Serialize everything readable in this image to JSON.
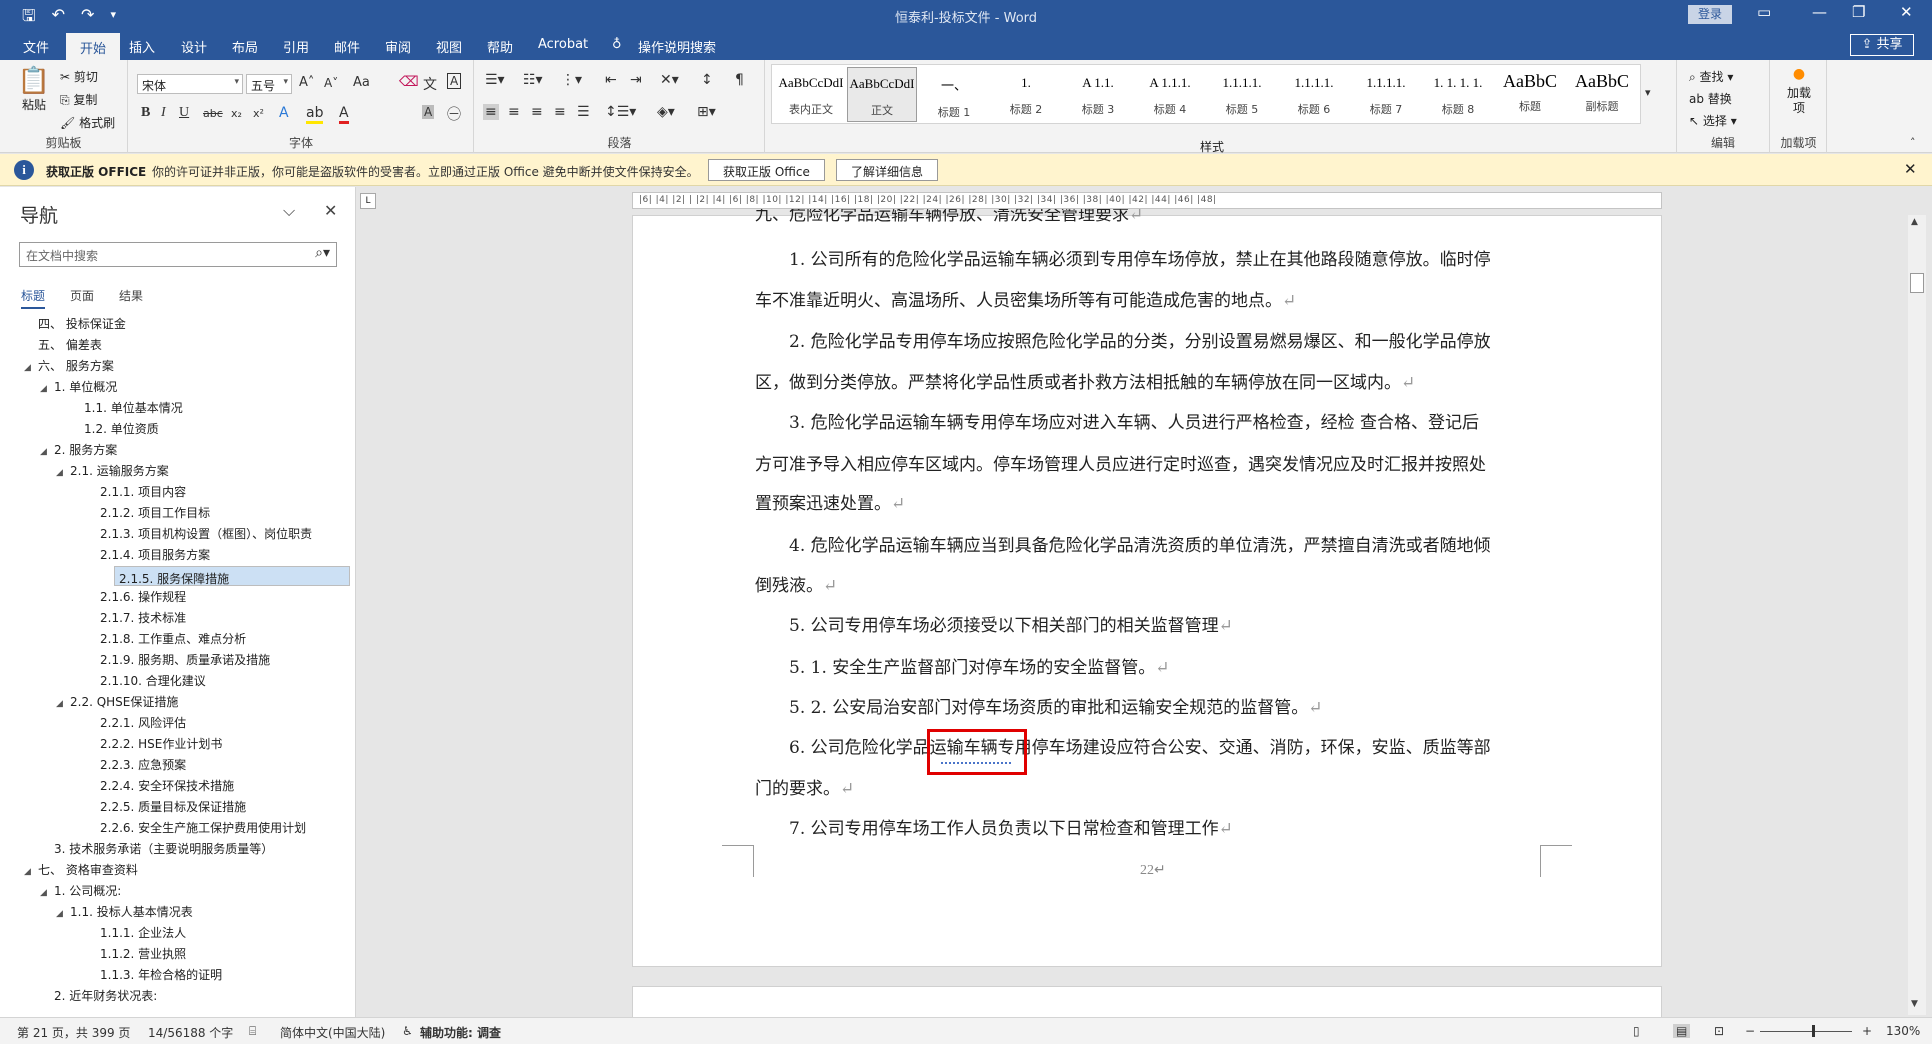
{
  "window": {
    "title": "恒泰利-投标文件 - Word",
    "login_label": "登录",
    "share_label": "共享"
  },
  "tabs": [
    "文件",
    "开始",
    "插入",
    "设计",
    "布局",
    "引用",
    "邮件",
    "审阅",
    "视图",
    "帮助",
    "Acrobat",
    "操作说明搜索"
  ],
  "ribbon": {
    "clipboard": {
      "paste": "粘贴",
      "cut": "剪切",
      "copy": "复制",
      "format_painter": "格式刷",
      "label": "剪贴板"
    },
    "font": {
      "font_name": "宋体",
      "font_size": "五号",
      "label": "字体",
      "case": "Aa"
    },
    "paragraph": {
      "label": "段落"
    },
    "styles": {
      "label": "样式",
      "items": [
        {
          "sample": "AaBbCcDdI",
          "name": "表内正文"
        },
        {
          "sample": "AaBbCcDdI",
          "name": "正文"
        },
        {
          "sample": "一、",
          "name": "标题 1"
        },
        {
          "sample": "1.",
          "name": "标题 2"
        },
        {
          "sample": "A 1.1.",
          "name": "标题 3"
        },
        {
          "sample": "A 1.1.1.",
          "name": "标题 4"
        },
        {
          "sample": "1.1.1.1.",
          "name": "标题 5"
        },
        {
          "sample": "1.1.1.1.",
          "name": "标题 6"
        },
        {
          "sample": "1.1.1.1.",
          "name": "标题 7"
        },
        {
          "sample": "1. 1. 1. 1.",
          "name": "标题 8"
        },
        {
          "sample": "AaBbC",
          "name": "标题"
        },
        {
          "sample": "AaBbC",
          "name": "副标题"
        }
      ]
    },
    "editing": {
      "find": "查找",
      "replace": "替换",
      "select": "选择",
      "label": "编辑"
    },
    "addins": {
      "name": "加载项",
      "label": "加载项"
    }
  },
  "message_bar": {
    "title": "获取正版 OFFICE",
    "text": "你的许可证并非正版，你可能是盗版软件的受害者。立即通过正版 Office 避免中断并使文件保持安全。",
    "btn_get": "获取正版 Office",
    "btn_more": "了解详细信息"
  },
  "nav": {
    "title": "导航",
    "search_placeholder": "在文档中搜索",
    "tabs": [
      "标题",
      "页面",
      "结果"
    ],
    "tree": [
      {
        "label": "四、 投标保证金",
        "level": 0,
        "toggle": ""
      },
      {
        "label": "五、 偏差表",
        "level": 0,
        "toggle": ""
      },
      {
        "label": "六、 服务方案",
        "level": 0,
        "toggle": "◢"
      },
      {
        "label": "1. 单位概况",
        "level": 1,
        "toggle": "◢"
      },
      {
        "label": "1.1. 单位基本情况",
        "level": 2,
        "toggle": ""
      },
      {
        "label": "1.2. 单位资质",
        "level": 2,
        "toggle": ""
      },
      {
        "label": "2. 服务方案",
        "level": 1,
        "toggle": "◢"
      },
      {
        "label": "2.1. 运输服务方案",
        "level": 2,
        "toggle": "◢"
      },
      {
        "label": "2.1.1. 项目内容",
        "level": 3,
        "toggle": ""
      },
      {
        "label": "2.1.2. 项目工作目标",
        "level": 3,
        "toggle": ""
      },
      {
        "label": "2.1.3. 项目机构设置（框图）、岗位职责",
        "level": 3,
        "toggle": ""
      },
      {
        "label": "2.1.4. 项目服务方案",
        "level": 3,
        "toggle": ""
      },
      {
        "label": "2.1.5. 服务保障措施",
        "level": 3,
        "toggle": "",
        "selected": true
      },
      {
        "label": "2.1.6. 操作规程",
        "level": 3,
        "toggle": ""
      },
      {
        "label": "2.1.7. 技术标准",
        "level": 3,
        "toggle": ""
      },
      {
        "label": "2.1.8. 工作重点、难点分析",
        "level": 3,
        "toggle": ""
      },
      {
        "label": "2.1.9. 服务期、质量承诺及措施",
        "level": 3,
        "toggle": ""
      },
      {
        "label": "2.1.10. 合理化建议",
        "level": 3,
        "toggle": ""
      },
      {
        "label": "2.2. QHSE保证措施",
        "level": 2,
        "toggle": "◢"
      },
      {
        "label": "2.2.1. 风险评估",
        "level": 3,
        "toggle": ""
      },
      {
        "label": "2.2.2. HSE作业计划书",
        "level": 3,
        "toggle": ""
      },
      {
        "label": "2.2.3. 应急预案",
        "level": 3,
        "toggle": ""
      },
      {
        "label": "2.2.4. 安全环保技术措施",
        "level": 3,
        "toggle": ""
      },
      {
        "label": "2.2.5. 质量目标及保证措施",
        "level": 3,
        "toggle": ""
      },
      {
        "label": "2.2.6. 安全生产施工保护费用使用计划",
        "level": 3,
        "toggle": ""
      },
      {
        "label": "3. 技术服务承诺（主要说明服务质量等）",
        "level": 1,
        "toggle": ""
      },
      {
        "label": "七、 资格审查资料",
        "level": 0,
        "toggle": "◢"
      },
      {
        "label": "1. 公司概况:",
        "level": 1,
        "toggle": "◢"
      },
      {
        "label": "1.1. 投标人基本情况表",
        "level": 2,
        "toggle": "◢"
      },
      {
        "label": "1.1.1. 企业法人",
        "level": 3,
        "toggle": ""
      },
      {
        "label": "1.1.2. 营业执照",
        "level": 3,
        "toggle": ""
      },
      {
        "label": "1.1.3. 年检合格的证明",
        "level": 3,
        "toggle": ""
      },
      {
        "label": "2. 近年财务状况表:",
        "level": 1,
        "toggle": ""
      }
    ]
  },
  "ruler_text": "|6| |4| |2| | |2| |4| |6| |8| |10| |12| |14| |16| |18| |20| |22| |24| |26| |28| |30| |32| |34| |36| |38| |40| |42| |44| |46| |48|",
  "document": {
    "lines": [
      {
        "text": "九、危险化学品运输车辆停放、清洗安全管理要求",
        "indent": false,
        "mark": "↵"
      },
      {
        "text": "1. 公司所有的危险化学品运输车辆必须到专用停车场停放，禁止在其他路段随意停放。临时停",
        "indent": true,
        "mark": ""
      },
      {
        "text": "车不准靠近明火、高温场所、人员密集场所等有可能造成危害的地点。",
        "indent": false,
        "mark": "↵"
      },
      {
        "text": "2. 危险化学品专用停车场应按照危险化学品的分类，分别设置易燃易爆区、和一般化学品停放",
        "indent": true,
        "mark": ""
      },
      {
        "text": "区，做到分类停放。严禁将化学品性质或者扑救方法相抵触的车辆停放在同一区域内。",
        "indent": false,
        "mark": "↵"
      },
      {
        "text": "3. 危险化学品运输车辆专用停车场应对进入车辆、人员进行严格检查，经检 查合格、登记后",
        "indent": true,
        "mark": ""
      },
      {
        "text": "方可准予导入相应停车区域内。停车场管理人员应进行定时巡查，遇突发情况应及时汇报并按照处",
        "indent": false,
        "mark": ""
      },
      {
        "text": "置预案迅速处置。",
        "indent": false,
        "mark": "↵"
      },
      {
        "text": "4. 危险化学品运输车辆应当到具备危险化学品清洗资质的单位清洗，严禁擅自清洗或者随地倾",
        "indent": true,
        "mark": ""
      },
      {
        "text": "倒残液。",
        "indent": false,
        "mark": "↵"
      },
      {
        "text": "5. 公司专用停车场必须接受以下相关部门的相关监督管理",
        "indent": true,
        "mark": "↵"
      },
      {
        "text": "5. 1. 安全生产监督部门对停车场的安全监督管。",
        "indent": true,
        "mark": "↵"
      },
      {
        "text": "5. 2. 公安局治安部门对停车场资质的审批和运输安全规范的监督管。",
        "indent": true,
        "mark": "↵"
      },
      {
        "text": "6. 公司危险化学品运输车辆专用停车场建设应符合公安、交通、消防，环保，安监、质监等部",
        "indent": true,
        "mark": ""
      },
      {
        "text": "门的要求。",
        "indent": false,
        "mark": "↵"
      },
      {
        "text": "7. 公司专用停车场工作人员负责以下日常检查和管理工作",
        "indent": true,
        "mark": "↵"
      }
    ],
    "page_number": "22↵"
  },
  "status": {
    "page": "第 21 页，共 399 页",
    "words": "14/56188 个字",
    "language": "简体中文(中国大陆)",
    "accessibility": "辅助功能: 调查",
    "zoom": "130%"
  },
  "colors": {
    "brand": "#2b579a",
    "message_bg": "#fff4ce",
    "highlight_box": "#e00000"
  }
}
